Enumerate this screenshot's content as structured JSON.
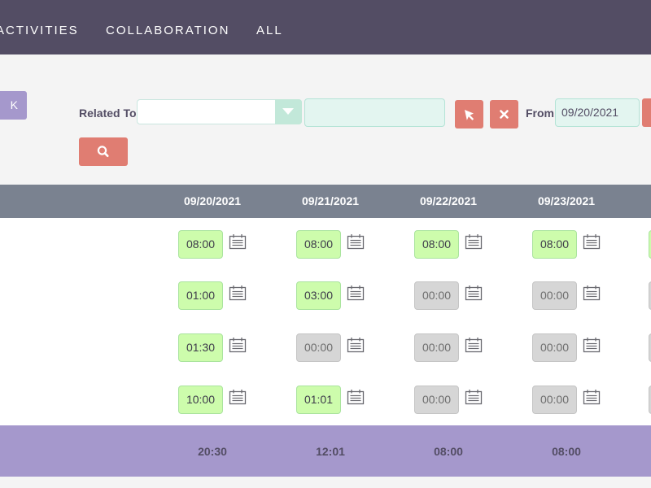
{
  "nav": {
    "items": [
      "ACTIVITIES",
      "COLLABORATION",
      "ALL"
    ]
  },
  "filters": {
    "back_label": "K",
    "related_label": "Related To",
    "related_value": "",
    "related_text": "",
    "from_label": "From",
    "from_value": "09/20/2021"
  },
  "table": {
    "dates": [
      "09/20/2021",
      "09/21/2021",
      "09/22/2021",
      "09/23/2021"
    ],
    "rows": [
      [
        "08:00",
        "08:00",
        "08:00",
        "08:00"
      ],
      [
        "01:00",
        "03:00",
        "00:00",
        "00:00"
      ],
      [
        "01:30",
        "00:00",
        "00:00",
        "00:00"
      ],
      [
        "10:00",
        "01:01",
        "00:00",
        "00:00"
      ]
    ],
    "totals": [
      "20:30",
      "12:01",
      "08:00",
      "08:00"
    ]
  },
  "icons": {
    "select": "cursor-arrow-icon",
    "clear": "close-icon",
    "search": "search-icon",
    "calendar": "calendar-icon"
  },
  "colors": {
    "nav_bg": "#534d64",
    "accent": "#e07d72",
    "header_bg": "#7a8290",
    "footer_bg": "#a598cc",
    "filled_cell": "#cdfcac",
    "empty_cell": "#d6d6d6"
  }
}
